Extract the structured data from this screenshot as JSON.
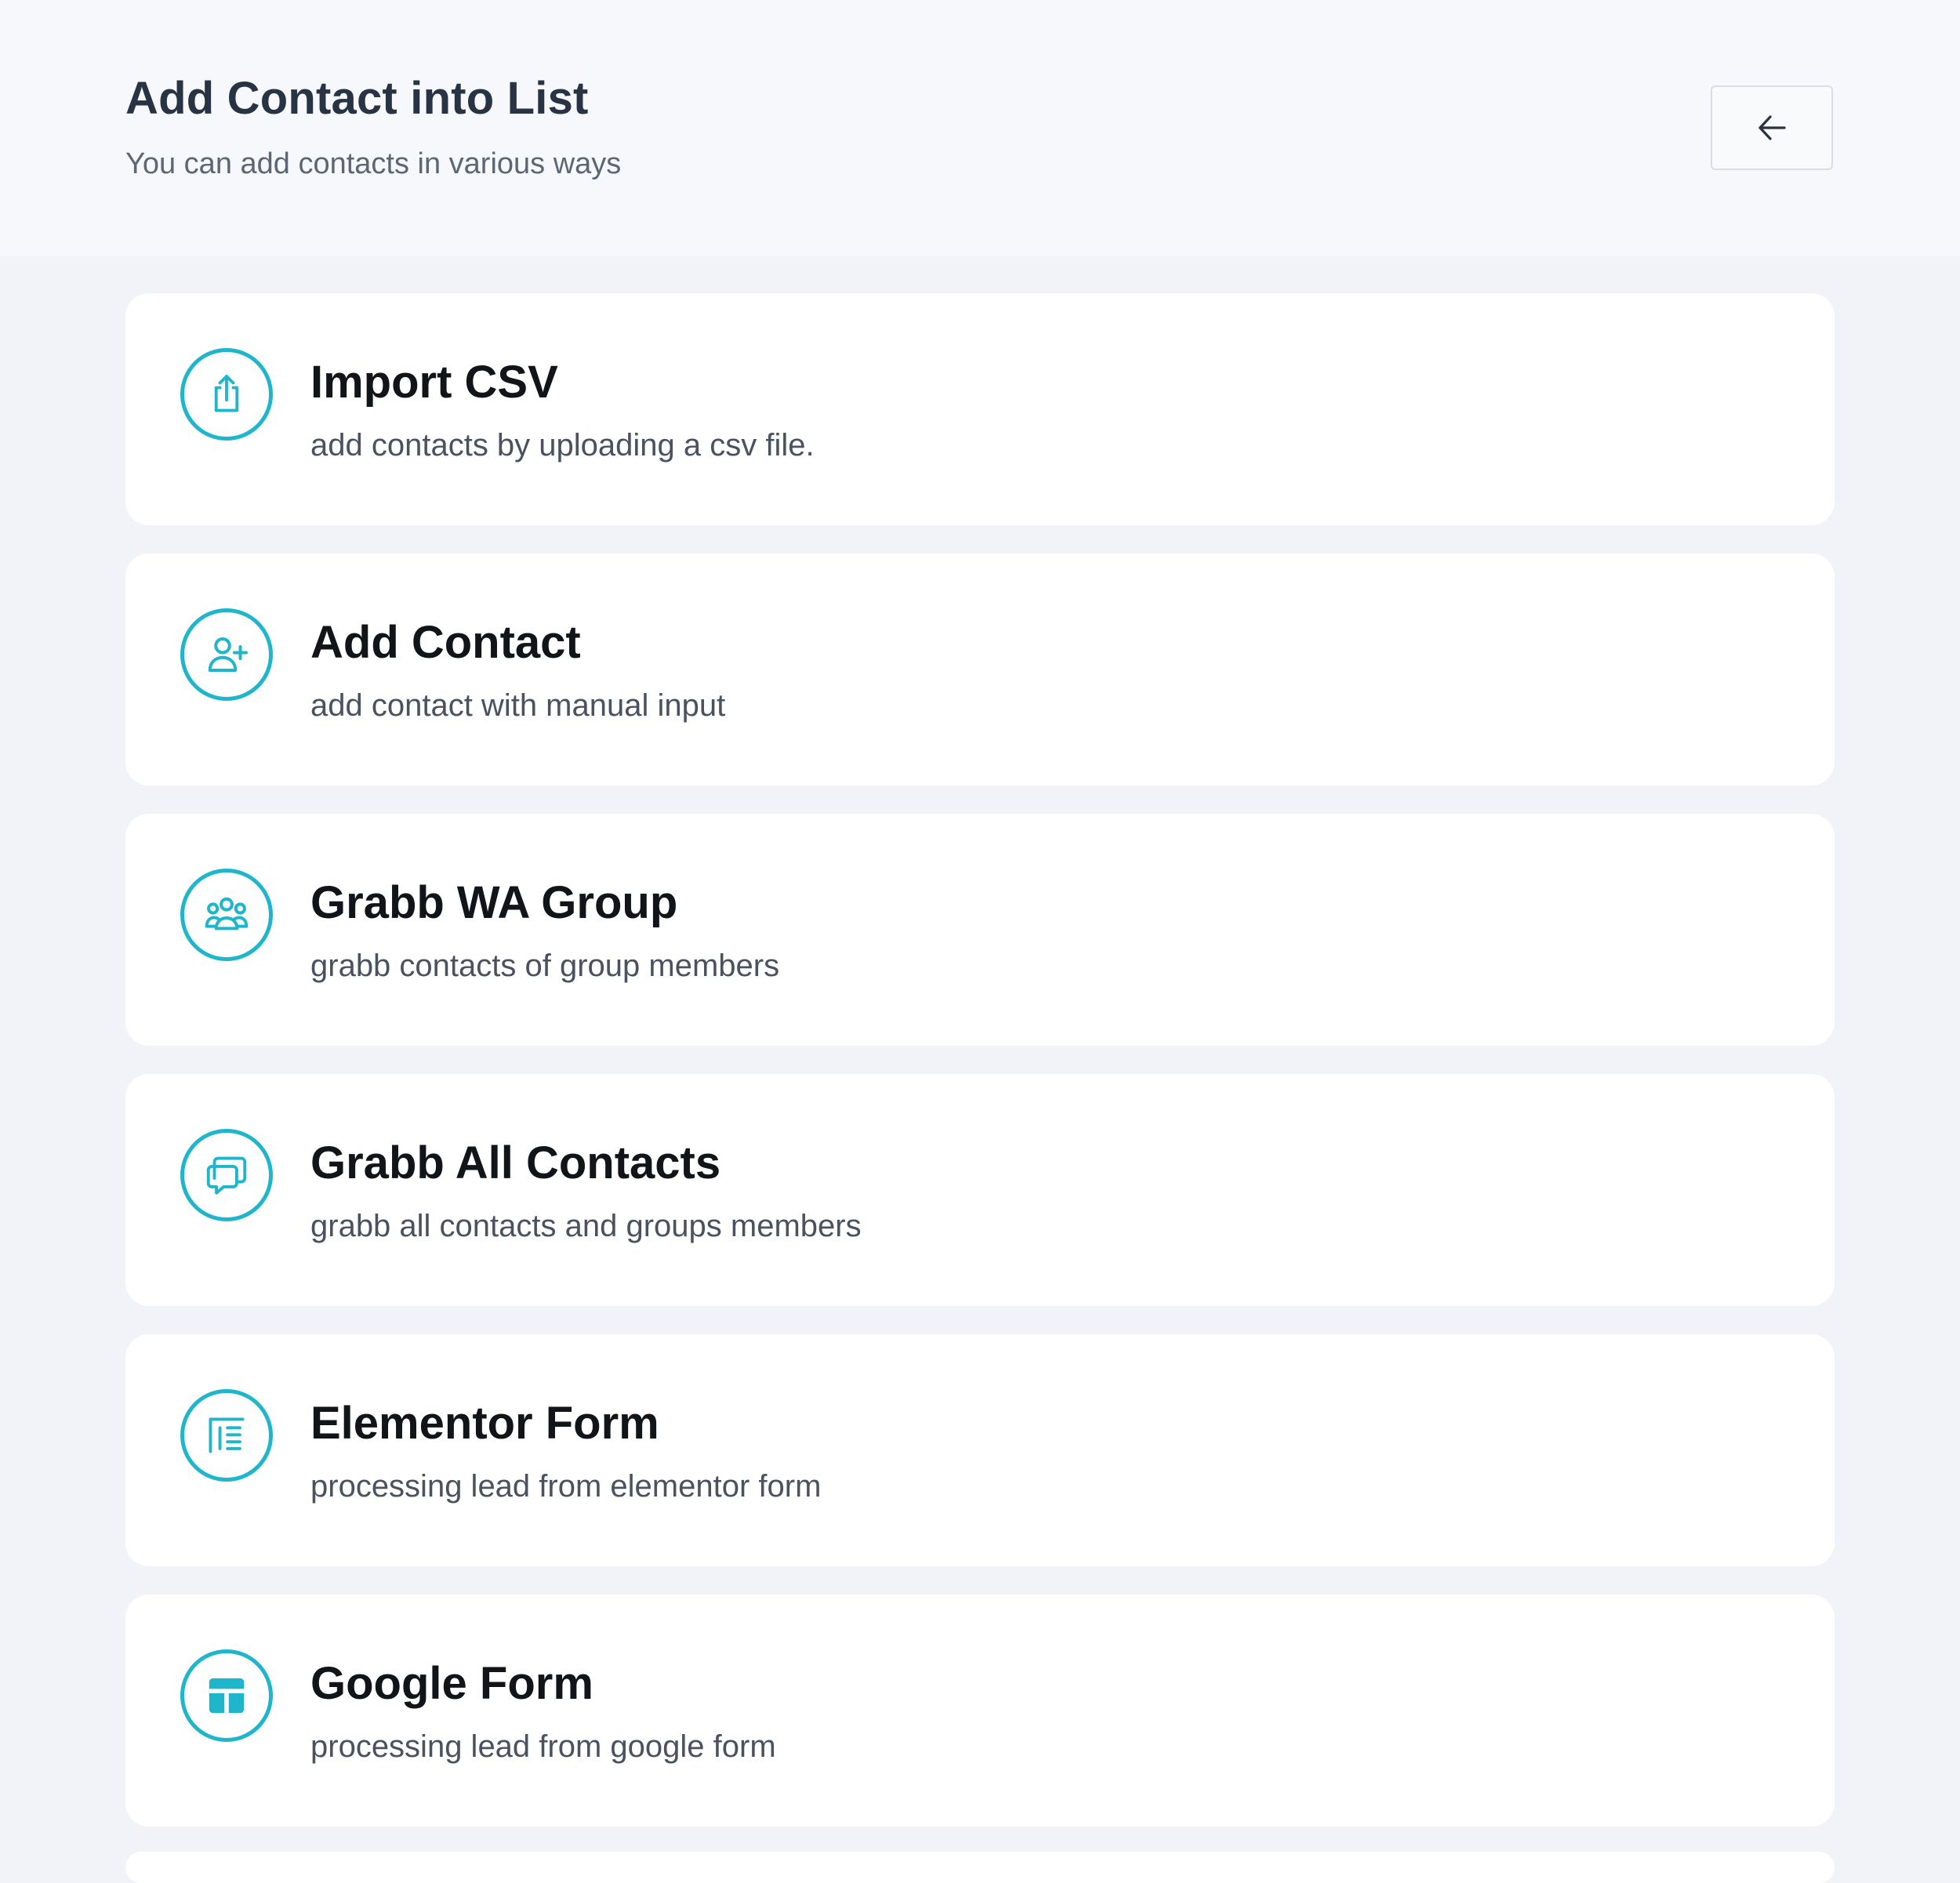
{
  "header": {
    "title": "Add Contact into List",
    "subtitle": "You can add contacts in various ways",
    "back_icon": "arrow-left-icon"
  },
  "options": [
    {
      "title": "Import CSV",
      "description": "add contacts by uploading a csv file.",
      "icon": "upload-icon"
    },
    {
      "title": "Add Contact",
      "description": "add contact with manual input",
      "icon": "user-add-icon"
    },
    {
      "title": "Grabb WA Group",
      "description": "grabb contacts of group members",
      "icon": "group-icon"
    },
    {
      "title": "Grabb All Contacts",
      "description": "grabb all contacts and groups members",
      "icon": "chat-bubbles-icon"
    },
    {
      "title": "Elementor Form",
      "description": "processing lead from elementor form",
      "icon": "elementor-icon"
    },
    {
      "title": "Google Form",
      "description": "processing lead from google form",
      "icon": "google-form-icon"
    }
  ],
  "colors": {
    "accent": "#1fb6cc",
    "background": "#f1f3f8",
    "header_background": "#f7f8fb",
    "card_background": "#ffffff",
    "title_text": "#111418",
    "muted_text": "#4a5260"
  }
}
